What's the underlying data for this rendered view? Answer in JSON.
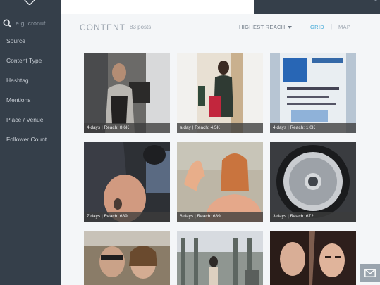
{
  "search": {
    "placeholder": "e.g. cronut"
  },
  "sidebar": {
    "items": [
      {
        "label": "Source"
      },
      {
        "label": "Content Type"
      },
      {
        "label": "Hashtag"
      },
      {
        "label": "Mentions"
      },
      {
        "label": "Place / Venue"
      },
      {
        "label": "Follower Count"
      }
    ]
  },
  "header": {
    "title": "CONTENT",
    "post_count": "83 posts",
    "sort_label": "HIGHEST REACH",
    "views": {
      "grid": "GRID",
      "separator": "|",
      "map": "MAP"
    },
    "active_view": "GRID"
  },
  "posts": [
    {
      "caption": "4 days | Reach: 8.6K"
    },
    {
      "caption": "a day | Reach: 4.5K"
    },
    {
      "caption": "4 days | Reach: 1.0K"
    },
    {
      "caption": "7 days | Reach: 689"
    },
    {
      "caption": "6 days | Reach: 689"
    },
    {
      "caption": "3 days | Reach: 672"
    },
    {
      "caption": ""
    },
    {
      "caption": ""
    },
    {
      "caption": ""
    }
  ],
  "colors": {
    "sidebar": "#353f4a",
    "accent": "#3aa6d6",
    "background": "#f4f6f8"
  },
  "icons": {
    "logo": "diamond-logo-icon",
    "search": "search-icon",
    "sort": "caret-down-icon",
    "feedback": "envelope-icon"
  }
}
